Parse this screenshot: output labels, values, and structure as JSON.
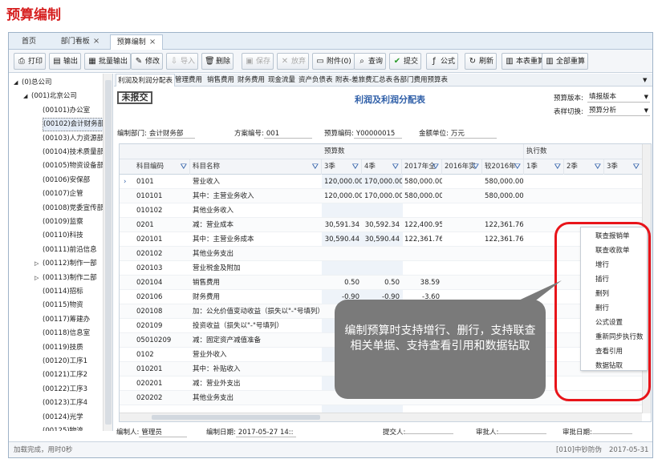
{
  "page_title": "预算编制",
  "tabs": [
    {
      "label": "首页",
      "closable": false
    },
    {
      "label": "部门看板",
      "closable": true
    },
    {
      "label": "预算编制",
      "closable": true
    }
  ],
  "toolbar": [
    {
      "label": "打印",
      "icon": "printer-icon",
      "enabled": true
    },
    {
      "label": "输出",
      "icon": "export-icon",
      "enabled": true
    },
    {
      "label": "批量输出",
      "icon": "batch-export-icon",
      "enabled": true
    },
    {
      "label": "修改",
      "icon": "edit-icon",
      "enabled": true
    },
    {
      "label": "导入",
      "icon": "import-icon",
      "enabled": false
    },
    {
      "label": "删除",
      "icon": "trash-icon",
      "enabled": true
    },
    {
      "label": "保存",
      "icon": "save-icon",
      "enabled": false
    },
    {
      "label": "放弃",
      "icon": "cancel-icon",
      "enabled": false
    },
    {
      "label": "附件(0)",
      "icon": "attachment-icon",
      "enabled": true
    },
    {
      "label": "查询",
      "icon": "search-icon",
      "enabled": true
    },
    {
      "label": "提交",
      "icon": "check-icon",
      "enabled": true
    },
    {
      "label": "公式",
      "icon": "formula-icon",
      "enabled": true
    },
    {
      "label": "刷新",
      "icon": "refresh-icon",
      "enabled": true
    },
    {
      "label": "本表重算",
      "icon": "recalc-icon",
      "enabled": true
    },
    {
      "label": "全部重算",
      "icon": "recalc-all-icon",
      "enabled": true
    }
  ],
  "tree": [
    {
      "label": "(0)总公司",
      "level": 0,
      "expander": "▲"
    },
    {
      "label": "(001)北京公司",
      "level": 1,
      "expander": "▲"
    },
    {
      "label": "(00101)办公室",
      "level": 2,
      "expander": ""
    },
    {
      "label": "(00102)会计财务部",
      "level": 2,
      "expander": "",
      "selected": true
    },
    {
      "label": "(00103)人力资源部",
      "level": 2,
      "expander": ""
    },
    {
      "label": "(00104)技术质量部",
      "level": 2,
      "expander": ""
    },
    {
      "label": "(00105)物资设备部",
      "level": 2,
      "expander": ""
    },
    {
      "label": "(00106)安保部",
      "level": 2,
      "expander": ""
    },
    {
      "label": "(00107)企管",
      "level": 2,
      "expander": ""
    },
    {
      "label": "(00108)党委宣传部",
      "level": 2,
      "expander": ""
    },
    {
      "label": "(00109)监察",
      "level": 2,
      "expander": ""
    },
    {
      "label": "(00110)科技",
      "level": 2,
      "expander": ""
    },
    {
      "label": "(00111)前沿信息",
      "level": 2,
      "expander": ""
    },
    {
      "label": "(00112)制作一部",
      "level": 2,
      "expander": "▷"
    },
    {
      "label": "(00113)制作二部",
      "level": 2,
      "expander": "▷"
    },
    {
      "label": "(00114)招标",
      "level": 2,
      "expander": ""
    },
    {
      "label": "(00115)物资",
      "level": 2,
      "expander": ""
    },
    {
      "label": "(00117)筹建办",
      "level": 2,
      "expander": ""
    },
    {
      "label": "(00118)信息室",
      "level": 2,
      "expander": ""
    },
    {
      "label": "(00119)技质",
      "level": 2,
      "expander": ""
    },
    {
      "label": "(00120)工序1",
      "level": 2,
      "expander": ""
    },
    {
      "label": "(00121)工序2",
      "level": 2,
      "expander": ""
    },
    {
      "label": "(00122)工序3",
      "level": 2,
      "expander": ""
    },
    {
      "label": "(00123)工序4",
      "level": 2,
      "expander": ""
    },
    {
      "label": "(00124)光学",
      "level": 2,
      "expander": ""
    },
    {
      "label": "(00125)物流",
      "level": 2,
      "expander": ""
    }
  ],
  "subtabs": [
    "利润及利润分配表",
    "管理费用",
    "销售费用",
    "财务费用",
    "现金流量",
    "资产负债表",
    "附表-差旅费汇总表",
    "各部门费用预算表"
  ],
  "stamp": "未报交",
  "report_title": "利润及利润分配表",
  "version_label": "预算版本:",
  "version_value": "填报版本",
  "switch_label": "表样切换:",
  "switch_value": "预算分析",
  "info": {
    "dept_label": "编制部门:",
    "dept_value": "会计财务部",
    "plan_label": "方案编号:",
    "plan_value": "001",
    "code_label": "预算编码:",
    "code_value": "Y00000015",
    "unit_label": "金额单位:",
    "unit_value": "万元"
  },
  "grid": {
    "group_budget": "预算数",
    "group_exec": "执行数",
    "columns": [
      "科目编码",
      "科目名称",
      "3季",
      "4季",
      "2017年全",
      "2016年实",
      "较2016年",
      "1季",
      "2季",
      "3季"
    ],
    "rows": [
      {
        "code": "0101",
        "name": "营业收入",
        "v3": "120,000.00",
        "v4": "170,000.00",
        "v2017": "580,000.00",
        "v2016": "",
        "vcmp": "580,000.00",
        "current": true
      },
      {
        "code": "010101",
        "name": "其中：主营业务收入",
        "v3": "120,000.00",
        "v4": "170,000.00",
        "v2017": "580,000.00",
        "v2016": "",
        "vcmp": "580,000.00"
      },
      {
        "code": "010102",
        "name": "其他业务收入",
        "v3": "",
        "v4": "",
        "v2017": "",
        "v2016": "",
        "vcmp": ""
      },
      {
        "code": "0201",
        "name": "减：营业成本",
        "v3": "30,591.34",
        "v4": "30,592.34",
        "v2017": "122,400.95",
        "v2016": "",
        "vcmp": "122,361.76"
      },
      {
        "code": "020101",
        "name": "其中：主营业务成本",
        "v3": "30,590.44",
        "v4": "30,590.44",
        "v2017": "122,361.76",
        "v2016": "",
        "vcmp": "122,361.76"
      },
      {
        "code": "020102",
        "name": "其他业务支出",
        "v3": "",
        "v4": "",
        "v2017": "",
        "v2016": "",
        "vcmp": ""
      },
      {
        "code": "020103",
        "name": "营业税金及附加",
        "v3": "",
        "v4": "",
        "v2017": "",
        "v2016": "",
        "vcmp": ""
      },
      {
        "code": "020104",
        "name": "销售费用",
        "v3": "0.50",
        "v4": "0.50",
        "v2017": "38.59",
        "v2016": "",
        "vcmp": ""
      },
      {
        "code": "020106",
        "name": "财务费用",
        "v3": "-0.90",
        "v4": "-0.90",
        "v2017": "-3.60",
        "v2016": "",
        "vcmp": ""
      },
      {
        "code": "020108",
        "name": "加：公允价值变动收益（损失以\"-\"号填列）",
        "v3": "",
        "v4": "",
        "v2017": "",
        "v2016": "",
        "vcmp": ""
      },
      {
        "code": "020109",
        "name": "投资收益（损失以\"-\"号填列）",
        "v3": "",
        "v4": "",
        "v2017": "",
        "v2016": "",
        "vcmp": ""
      },
      {
        "code": "05010209",
        "name": "减：固定资产减值准备",
        "v3": "",
        "v4": "",
        "v2017": "",
        "v2016": "",
        "vcmp": ""
      },
      {
        "code": "0102",
        "name": "营业外收入",
        "v3": "",
        "v4": "",
        "v2017": "",
        "v2016": "",
        "vcmp": ""
      },
      {
        "code": "010201",
        "name": "其中：补贴收入",
        "v3": "",
        "v4": "",
        "v2017": "",
        "v2016": "",
        "vcmp": ""
      },
      {
        "code": "020201",
        "name": "减：营业外支出",
        "v3": "",
        "v4": "",
        "v2017": "",
        "v2016": "",
        "vcmp": ""
      },
      {
        "code": "020202",
        "name": "其他业务支出",
        "v3": "",
        "v4": "",
        "v2017": "",
        "v2016": "",
        "vcmp": ""
      }
    ]
  },
  "context_menu": [
    "联查报销单",
    "联查收款单",
    "增行",
    "插行",
    "删列",
    "删行",
    "公式设置",
    "重新同步执行数",
    "查看引用",
    "数据钻取"
  ],
  "callout": "编制预算时支持增行、删行，支持联查相关单据、支持查看引用和数据钻取",
  "footer": {
    "editor_label": "编制人:",
    "editor_value": "管理员",
    "date_label": "编制日期:",
    "date_value": "2017-05-27 14::",
    "submitter_label": "提交人:",
    "submitter_value": "",
    "approver_label": "审批人:",
    "approver_value": "",
    "approve_date_label": "审批日期:",
    "approve_date_value": ""
  },
  "status": {
    "left": "加载完成，用时0秒",
    "user": "[010]中钞防伪",
    "date": "2017-05-31"
  }
}
